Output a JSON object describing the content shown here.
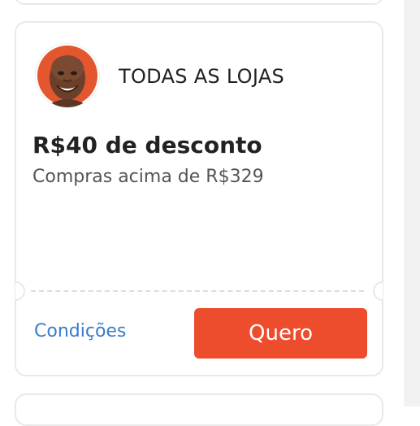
{
  "coupon": {
    "store_label": "TODAS AS LOJAS",
    "title": "R$40 de desconto",
    "subtitle": "Compras acima de R$329",
    "conditions_label": "Condições",
    "cta_label": "Quero",
    "avatar_icon": "person-avatar-icon",
    "accent_color": "#ee4d2d",
    "link_color": "#3a7bc8"
  }
}
